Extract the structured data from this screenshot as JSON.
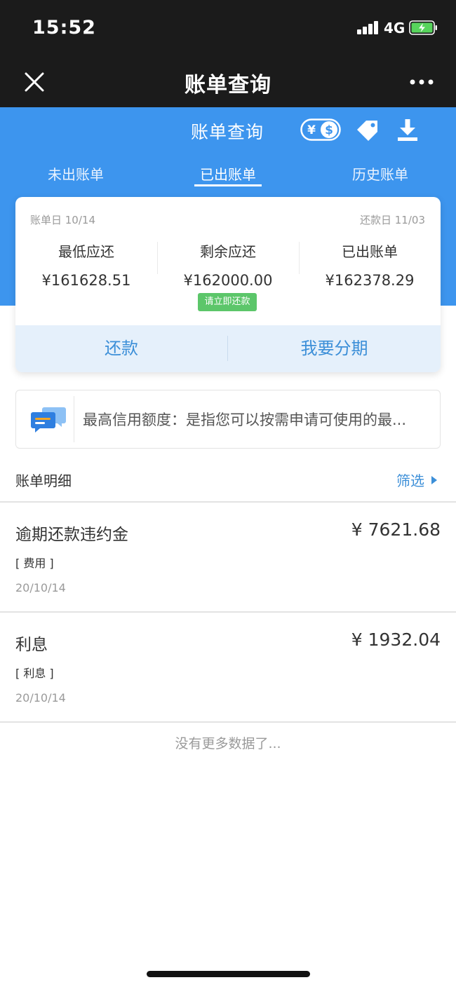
{
  "status_bar": {
    "time": "15:52",
    "network": "4G"
  },
  "nav": {
    "title": "账单查询"
  },
  "header": {
    "subtitle": "账单查询",
    "tabs": [
      {
        "label": "未出账单",
        "active": false
      },
      {
        "label": "已出账单",
        "active": true
      },
      {
        "label": "历史账单",
        "active": false
      }
    ]
  },
  "bill": {
    "bill_date": "账单日 10/14",
    "due_date": "还款日 11/03",
    "columns": [
      {
        "label": "最低应还",
        "value": "¥161628.51"
      },
      {
        "label": "剩余应还",
        "value": "¥162000.00"
      },
      {
        "label": "已出账单",
        "value": "¥162378.29"
      }
    ],
    "pay_now": "请立即还款",
    "repay_button": "还款",
    "installment_button": "我要分期"
  },
  "notice": {
    "text": "最高信用额度：是指您可以按需申请可使用的最..."
  },
  "details": {
    "title": "账单明细",
    "filter": "筛选",
    "items": [
      {
        "name": "逾期还款违约金",
        "amount": "¥ 7621.68",
        "tag": "[ 费用 ]",
        "date": "20/10/14"
      },
      {
        "name": "利息",
        "amount": "¥ 1932.04",
        "tag": "[ 利息 ]",
        "date": "20/10/14"
      }
    ],
    "no_more": "没有更多数据了..."
  },
  "colors": {
    "primary": "#3d95ee",
    "accent": "#3c8fd8",
    "badge": "#5cc66a",
    "dark": "#1b1b1b"
  }
}
